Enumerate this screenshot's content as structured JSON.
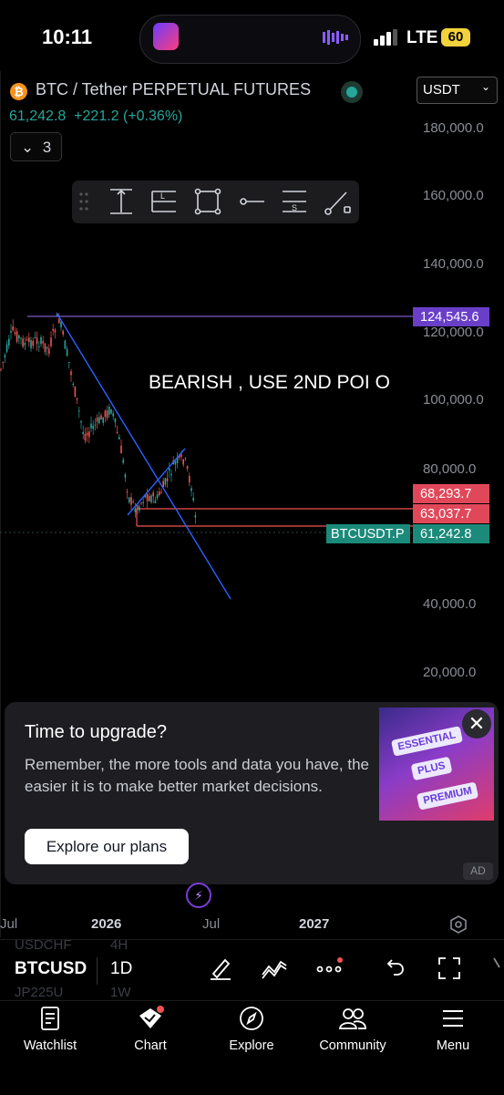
{
  "status_bar": {
    "time": "10:11",
    "network": "LTE",
    "battery": "60"
  },
  "header": {
    "symbol_title": "BTC / Tether PERPETUAL FUTURES",
    "currency": "USDT",
    "last_price": "61,242.8",
    "change": "+221.2 (+0.36%)",
    "collapse_count": "3"
  },
  "price_axis": [
    "180,000.0",
    "160,000.0",
    "140,000.0",
    "120,000.0",
    "100,000.0",
    "80,000.0",
    "40,000.0",
    "20,000.0"
  ],
  "price_tags": {
    "high": "124,545.6",
    "level_1": "68,293.7",
    "level_2": "63,037.7",
    "current": "61,242.8",
    "symbol": "BTCUSDT.P"
  },
  "annotation_text": "BEARISH , USE 2ND POI O",
  "colors": {
    "up": "#26a69a",
    "down": "#ef5350",
    "trendline": "#2962ff",
    "high_line": "#7e57c2",
    "accent": "#2962ff"
  },
  "promo": {
    "title": "Time to upgrade?",
    "text": "Remember, the more tools and data you have, the easier it is to make better market decisions.",
    "button": "Explore our plans",
    "badge": "AD",
    "pills": [
      "ESSENTIAL",
      "PLUS",
      "PREMIUM"
    ]
  },
  "time_axis": [
    "Jul",
    "2026",
    "Jul",
    "2027"
  ],
  "bottom_toolbar": {
    "symbol": "BTCUSD",
    "timeframe": "1D",
    "ghost_symbol_above": "USDCHF",
    "ghost_symbol_below": "JP225U",
    "ghost_tf_above": "4H",
    "ghost_tf_below": "1W"
  },
  "nav": [
    {
      "label": "Watchlist",
      "icon": "watchlist-icon"
    },
    {
      "label": "Chart",
      "icon": "chart-icon"
    },
    {
      "label": "Explore",
      "icon": "compass-icon"
    },
    {
      "label": "Community",
      "icon": "community-icon"
    },
    {
      "label": "Menu",
      "icon": "menu-icon"
    }
  ]
}
